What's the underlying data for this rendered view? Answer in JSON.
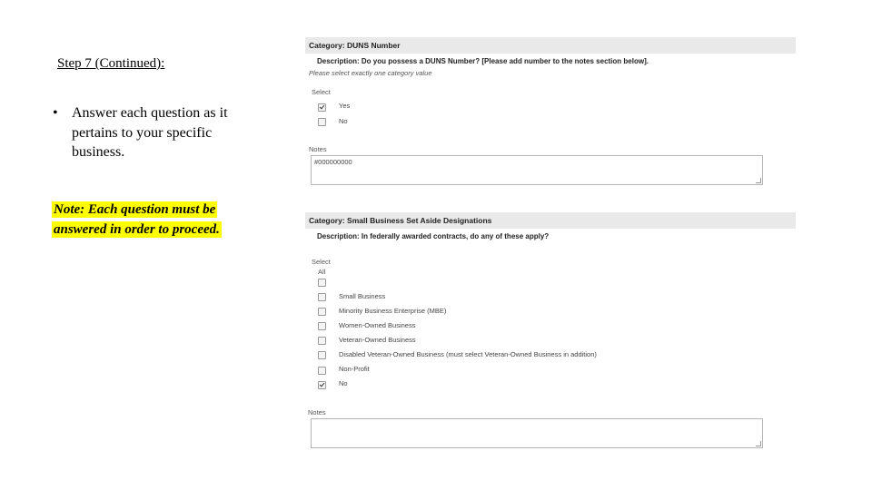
{
  "slide": {
    "step_title": "Step 7 (Continued):",
    "bullet_marker": "•",
    "bullet_text": "Answer each question as it pertains to your specific business.",
    "note_text": "Note: Each question must be answered in order to proceed."
  },
  "duns": {
    "category": "Category: DUNS Number",
    "description": "Description: Do you possess a DUNS Number? [Please add number to the notes section below].",
    "hint": "Please select exactly one category value",
    "select_label": "Select",
    "options": [
      {
        "label": "Yes",
        "checked": true
      },
      {
        "label": "No",
        "checked": false
      }
    ],
    "notes_label": "Notes",
    "notes_value": "#000000000"
  },
  "small_business": {
    "category": "Category: Small Business Set Aside Designations",
    "description": "Description: In federally awarded contracts, do any of these apply?",
    "select_label": "Select",
    "select_all_label": "All",
    "options": [
      {
        "label": "Small Business",
        "checked": false
      },
      {
        "label": "Minority Business Enterprise (MBE)",
        "checked": false
      },
      {
        "label": "Women-Owned Business",
        "checked": false
      },
      {
        "label": "Veteran-Owned Business",
        "checked": false
      },
      {
        "label": "Disabled Veteran-Owned Business (must select Veteran-Owned Business in addition)",
        "checked": false
      },
      {
        "label": "Non-Profit",
        "checked": false
      },
      {
        "label": "No",
        "checked": true
      }
    ],
    "notes_label": "Notes",
    "notes_value": ""
  }
}
